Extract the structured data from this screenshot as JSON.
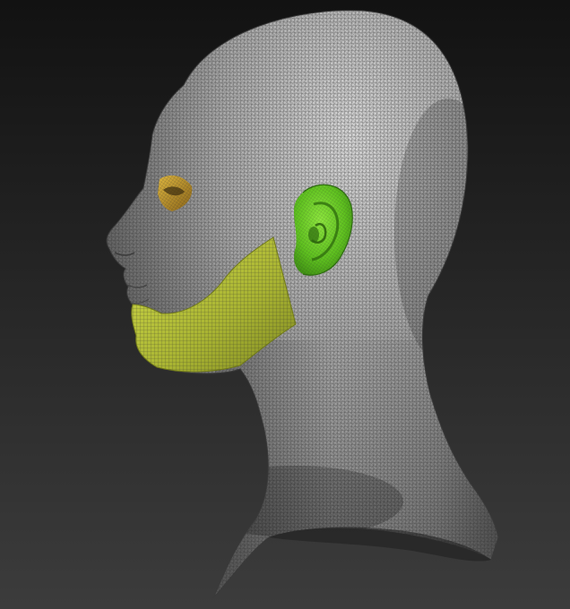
{
  "viewport": {
    "background_top": "#121212",
    "background_bottom": "#3c3c3c"
  },
  "model": {
    "subject": "head-bust-wireframe-mesh",
    "view": "left-profile",
    "display_mode": "polyframe",
    "mesh_color": "#9a9a9a",
    "wire_color": "#3a3a3a"
  },
  "polygroups": [
    {
      "name": "face-skin",
      "color": "#a9a9a9"
    },
    {
      "name": "jaw-cheek",
      "color": "#b8c43a"
    },
    {
      "name": "ear",
      "color": "#6fd12a"
    },
    {
      "name": "eye-socket",
      "color": "#c79a2c"
    }
  ]
}
